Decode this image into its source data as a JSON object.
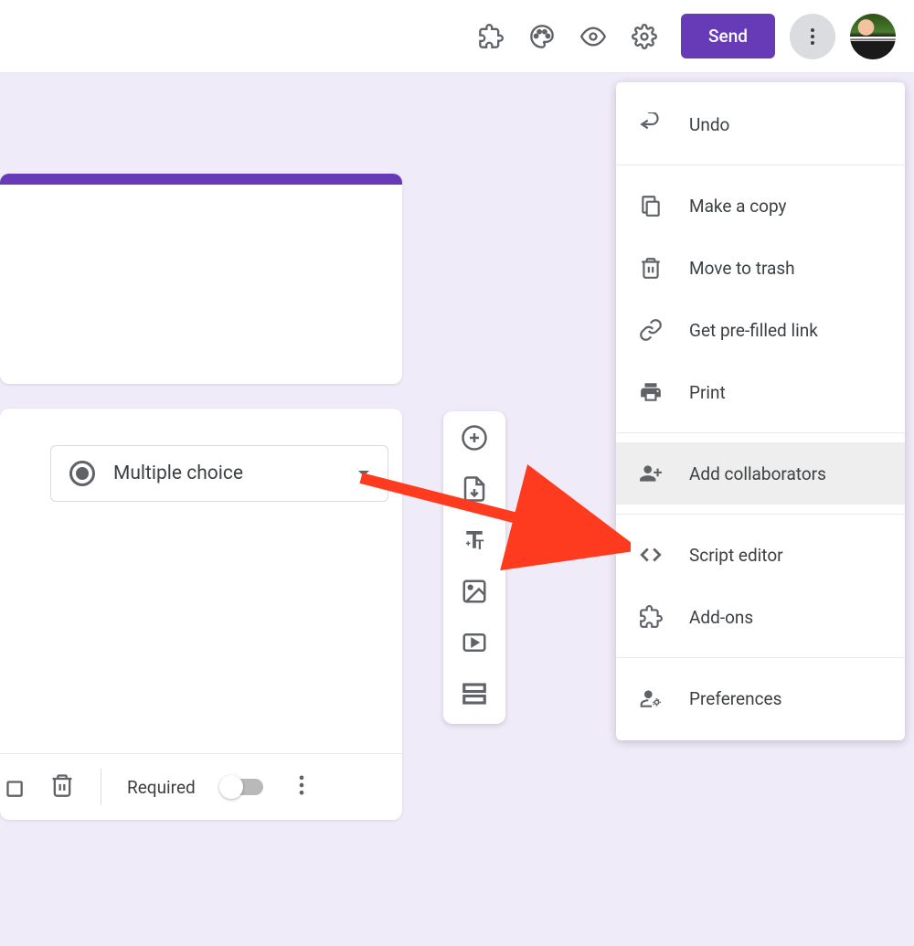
{
  "header": {
    "send_label": "Send"
  },
  "question": {
    "type_label": "Multiple choice",
    "required_label": "Required"
  },
  "menu": {
    "undo": "Undo",
    "make_copy": "Make a copy",
    "move_trash": "Move to trash",
    "prefilled_link": "Get pre-filled link",
    "print": "Print",
    "add_collaborators": "Add collaborators",
    "script_editor": "Script editor",
    "addons": "Add-ons",
    "preferences": "Preferences"
  }
}
